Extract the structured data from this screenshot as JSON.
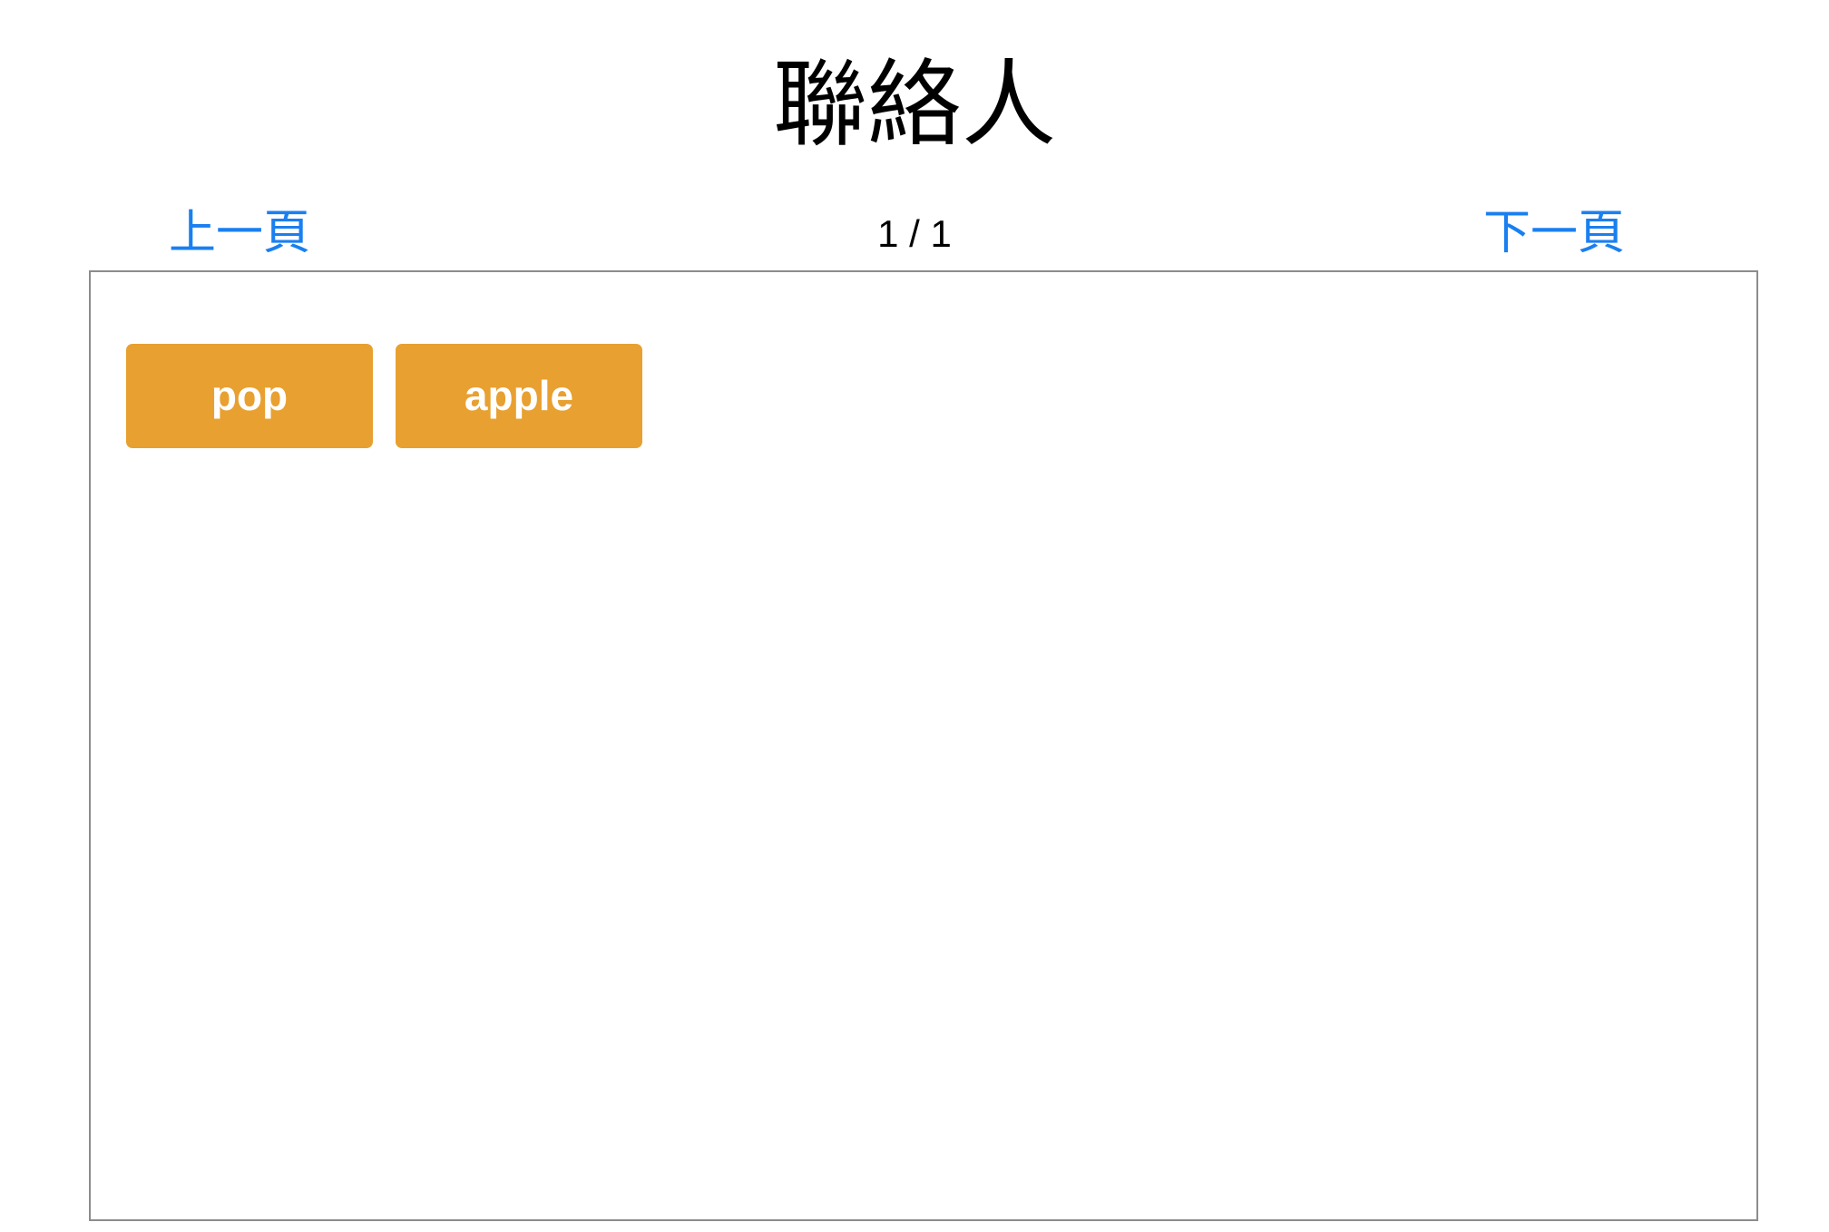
{
  "header": {
    "title": "聯絡人"
  },
  "pagination": {
    "prev_label": "上一頁",
    "next_label": "下一頁",
    "indicator": "1 / 1"
  },
  "contacts": [
    {
      "name": "pop"
    },
    {
      "name": "apple"
    }
  ],
  "colors": {
    "link": "#1a7ff0",
    "button_bg": "#e8a030",
    "button_text": "#ffffff",
    "panel_border": "#8c8c8c"
  }
}
